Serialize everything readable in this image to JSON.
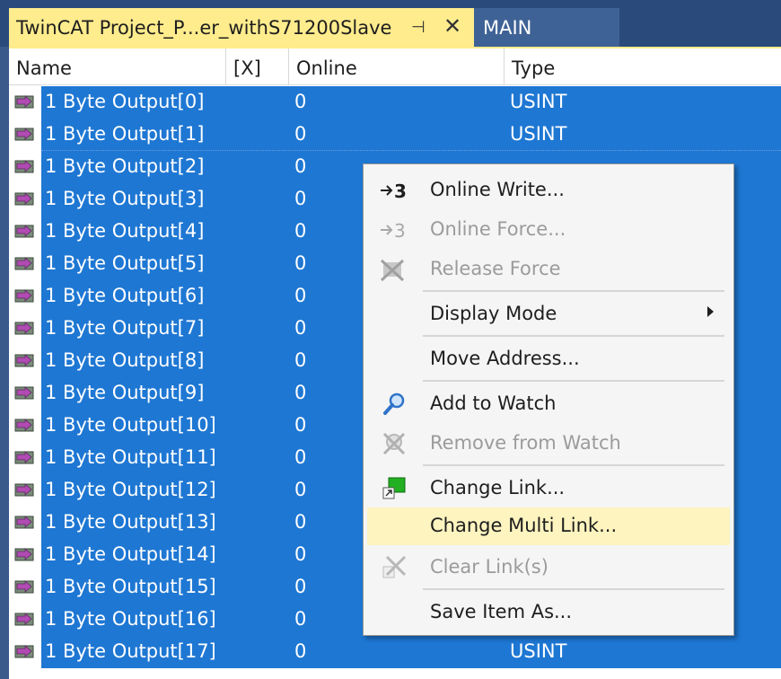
{
  "tabs": {
    "active_title": "TwinCAT Project_P...er_withS71200Slave",
    "pin_glyph": "⊣",
    "close_glyph": "✕",
    "inactive_title": "MAIN"
  },
  "grid": {
    "headers": {
      "name": "Name",
      "x": "[X]",
      "online": "Online",
      "type": "Type"
    },
    "rows": [
      {
        "name": "1 Byte Output[0]",
        "online": "0",
        "type": "USINT"
      },
      {
        "name": "1 Byte Output[1]",
        "online": "0",
        "type": "USINT"
      },
      {
        "name": "1 Byte Output[2]",
        "online": "0",
        "type": ""
      },
      {
        "name": "1 Byte Output[3]",
        "online": "0",
        "type": ""
      },
      {
        "name": "1 Byte Output[4]",
        "online": "0",
        "type": ""
      },
      {
        "name": "1 Byte Output[5]",
        "online": "0",
        "type": ""
      },
      {
        "name": "1 Byte Output[6]",
        "online": "0",
        "type": ""
      },
      {
        "name": "1 Byte Output[7]",
        "online": "0",
        "type": ""
      },
      {
        "name": "1 Byte Output[8]",
        "online": "0",
        "type": ""
      },
      {
        "name": "1 Byte Output[9]",
        "online": "0",
        "type": ""
      },
      {
        "name": "1 Byte Output[10]",
        "online": "0",
        "type": ""
      },
      {
        "name": "1 Byte Output[11]",
        "online": "0",
        "type": ""
      },
      {
        "name": "1 Byte Output[12]",
        "online": "0",
        "type": ""
      },
      {
        "name": "1 Byte Output[13]",
        "online": "0",
        "type": ""
      },
      {
        "name": "1 Byte Output[14]",
        "online": "0",
        "type": ""
      },
      {
        "name": "1 Byte Output[15]",
        "online": "0",
        "type": ""
      },
      {
        "name": "1 Byte Output[16]",
        "online": "0",
        "type": ""
      },
      {
        "name": "1 Byte Output[17]",
        "online": "0",
        "type": "USINT"
      }
    ]
  },
  "context_menu": {
    "items": [
      {
        "label": "Online Write...",
        "icon": "online-write-icon",
        "enabled": true
      },
      {
        "label": "Online Force...",
        "icon": "online-force-icon",
        "enabled": false
      },
      {
        "label": "Release Force",
        "icon": "release-force-icon",
        "enabled": false
      },
      {
        "label": "Display Mode",
        "icon": "",
        "enabled": true,
        "submenu": true
      },
      {
        "label": "Move Address...",
        "icon": "",
        "enabled": true
      },
      {
        "label": "Add to Watch",
        "icon": "magnifier-icon",
        "enabled": true
      },
      {
        "label": "Remove from Watch",
        "icon": "remove-watch-icon",
        "enabled": false
      },
      {
        "label": "Change Link...",
        "icon": "change-link-icon",
        "enabled": true
      },
      {
        "label": "Change Multi Link...",
        "icon": "",
        "enabled": true,
        "highlighted": true
      },
      {
        "label": "Clear Link(s)",
        "icon": "clear-link-icon",
        "enabled": false
      },
      {
        "label": "Save Item As...",
        "icon": "",
        "enabled": true
      }
    ]
  },
  "colors": {
    "selection": "#1e77d3",
    "active_tab": "#ffec8d",
    "menu_hover": "#fdf4bf"
  }
}
